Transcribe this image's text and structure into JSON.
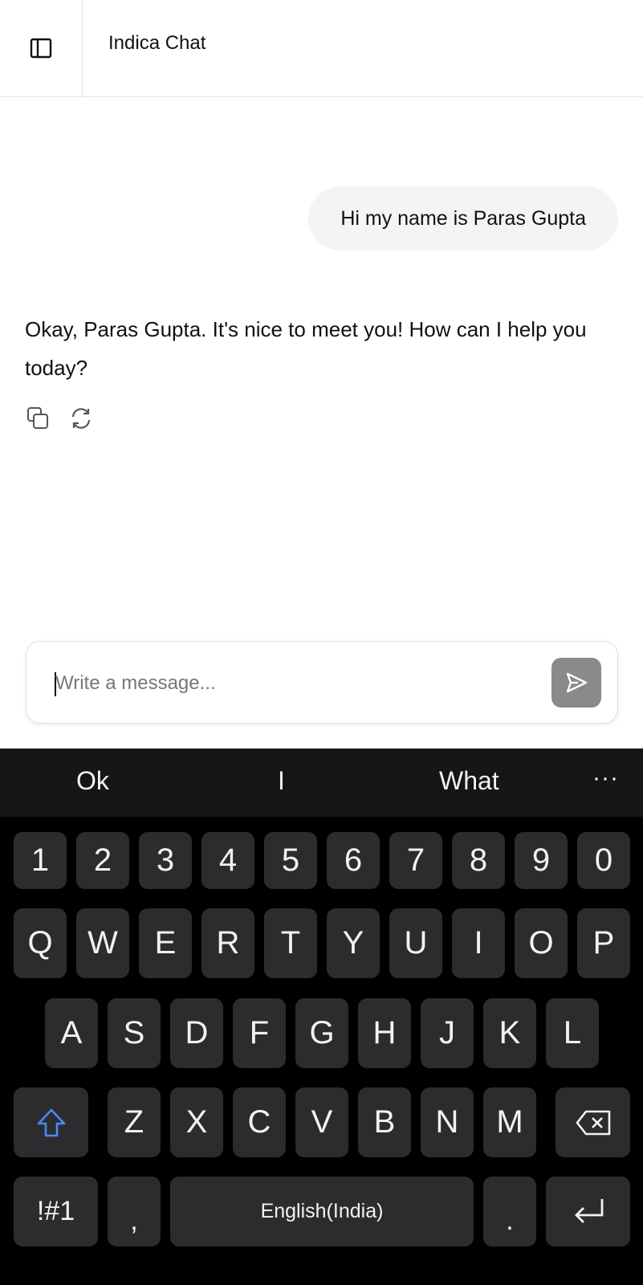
{
  "header": {
    "title": "Indica Chat",
    "sidebar_icon": "sidebar-toggle-icon"
  },
  "chat": {
    "user_message": "Hi my name is Paras Gupta",
    "assistant_message": "Okay, Paras Gupta. It's nice to meet you! How can I help you today?",
    "actions": [
      "copy-icon",
      "regenerate-icon"
    ]
  },
  "composer": {
    "placeholder": "Write a message...",
    "value": "",
    "send_icon": "send-icon",
    "send_color": "#8a8a8a"
  },
  "keyboard": {
    "suggestions": [
      "Ok",
      "I",
      "What"
    ],
    "more_label": "···",
    "numbers": [
      "1",
      "2",
      "3",
      "4",
      "5",
      "6",
      "7",
      "8",
      "9",
      "0"
    ],
    "row1": [
      "Q",
      "W",
      "E",
      "R",
      "T",
      "Y",
      "U",
      "I",
      "O",
      "P"
    ],
    "row2": [
      "A",
      "S",
      "D",
      "F",
      "G",
      "H",
      "J",
      "K",
      "L"
    ],
    "row3": [
      "Z",
      "X",
      "C",
      "V",
      "B",
      "N",
      "M"
    ],
    "symbols_label": "!#1",
    "comma_label": ",",
    "space_label": "English(India)",
    "period_label": ".",
    "shift_color": "#4a8af4"
  }
}
